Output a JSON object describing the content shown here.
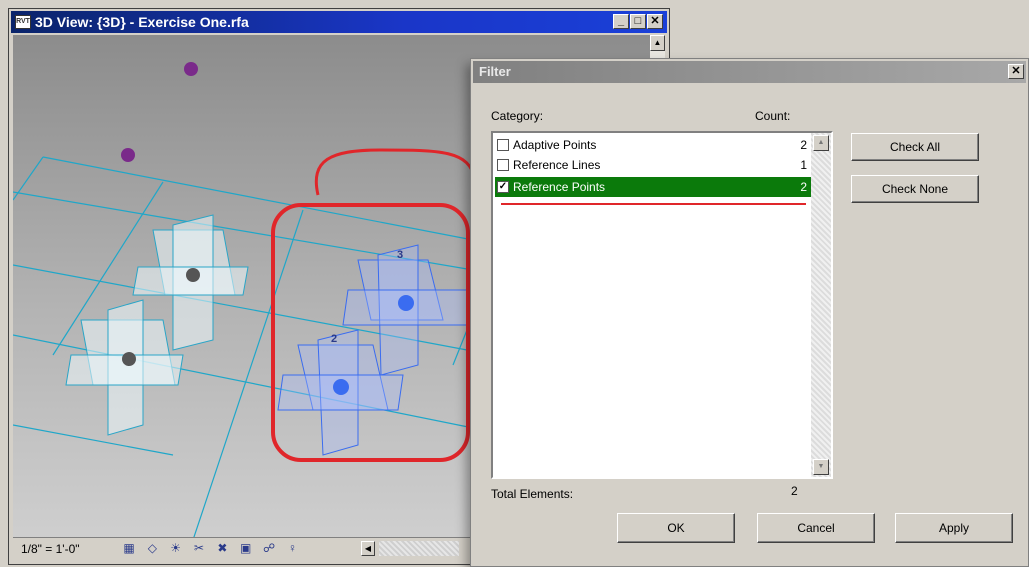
{
  "view_window": {
    "title": "3D View: {3D} - Exercise One.rfa",
    "app_icon_text": "RVT",
    "scale": "1/8\" = 1'-0\"",
    "point_labels": [
      "3",
      "2"
    ]
  },
  "filter": {
    "title": "Filter",
    "category_header": "Category:",
    "count_header": "Count:",
    "items": [
      {
        "name": "Adaptive Points",
        "count": "2",
        "checked": false
      },
      {
        "name": "Reference Lines",
        "count": "1",
        "checked": false
      },
      {
        "name": "Reference Points",
        "count": "2",
        "checked": true
      }
    ],
    "check_all": "Check All",
    "check_none": "Check None",
    "total_label": "Total Elements:",
    "total_value": "2",
    "ok": "OK",
    "cancel": "Cancel",
    "apply": "Apply"
  },
  "colors": {
    "selection": "#0b7a0b",
    "highlight": "#e0262a",
    "grid": "#1fa7c9",
    "reference_point": "#3a6cf0"
  }
}
